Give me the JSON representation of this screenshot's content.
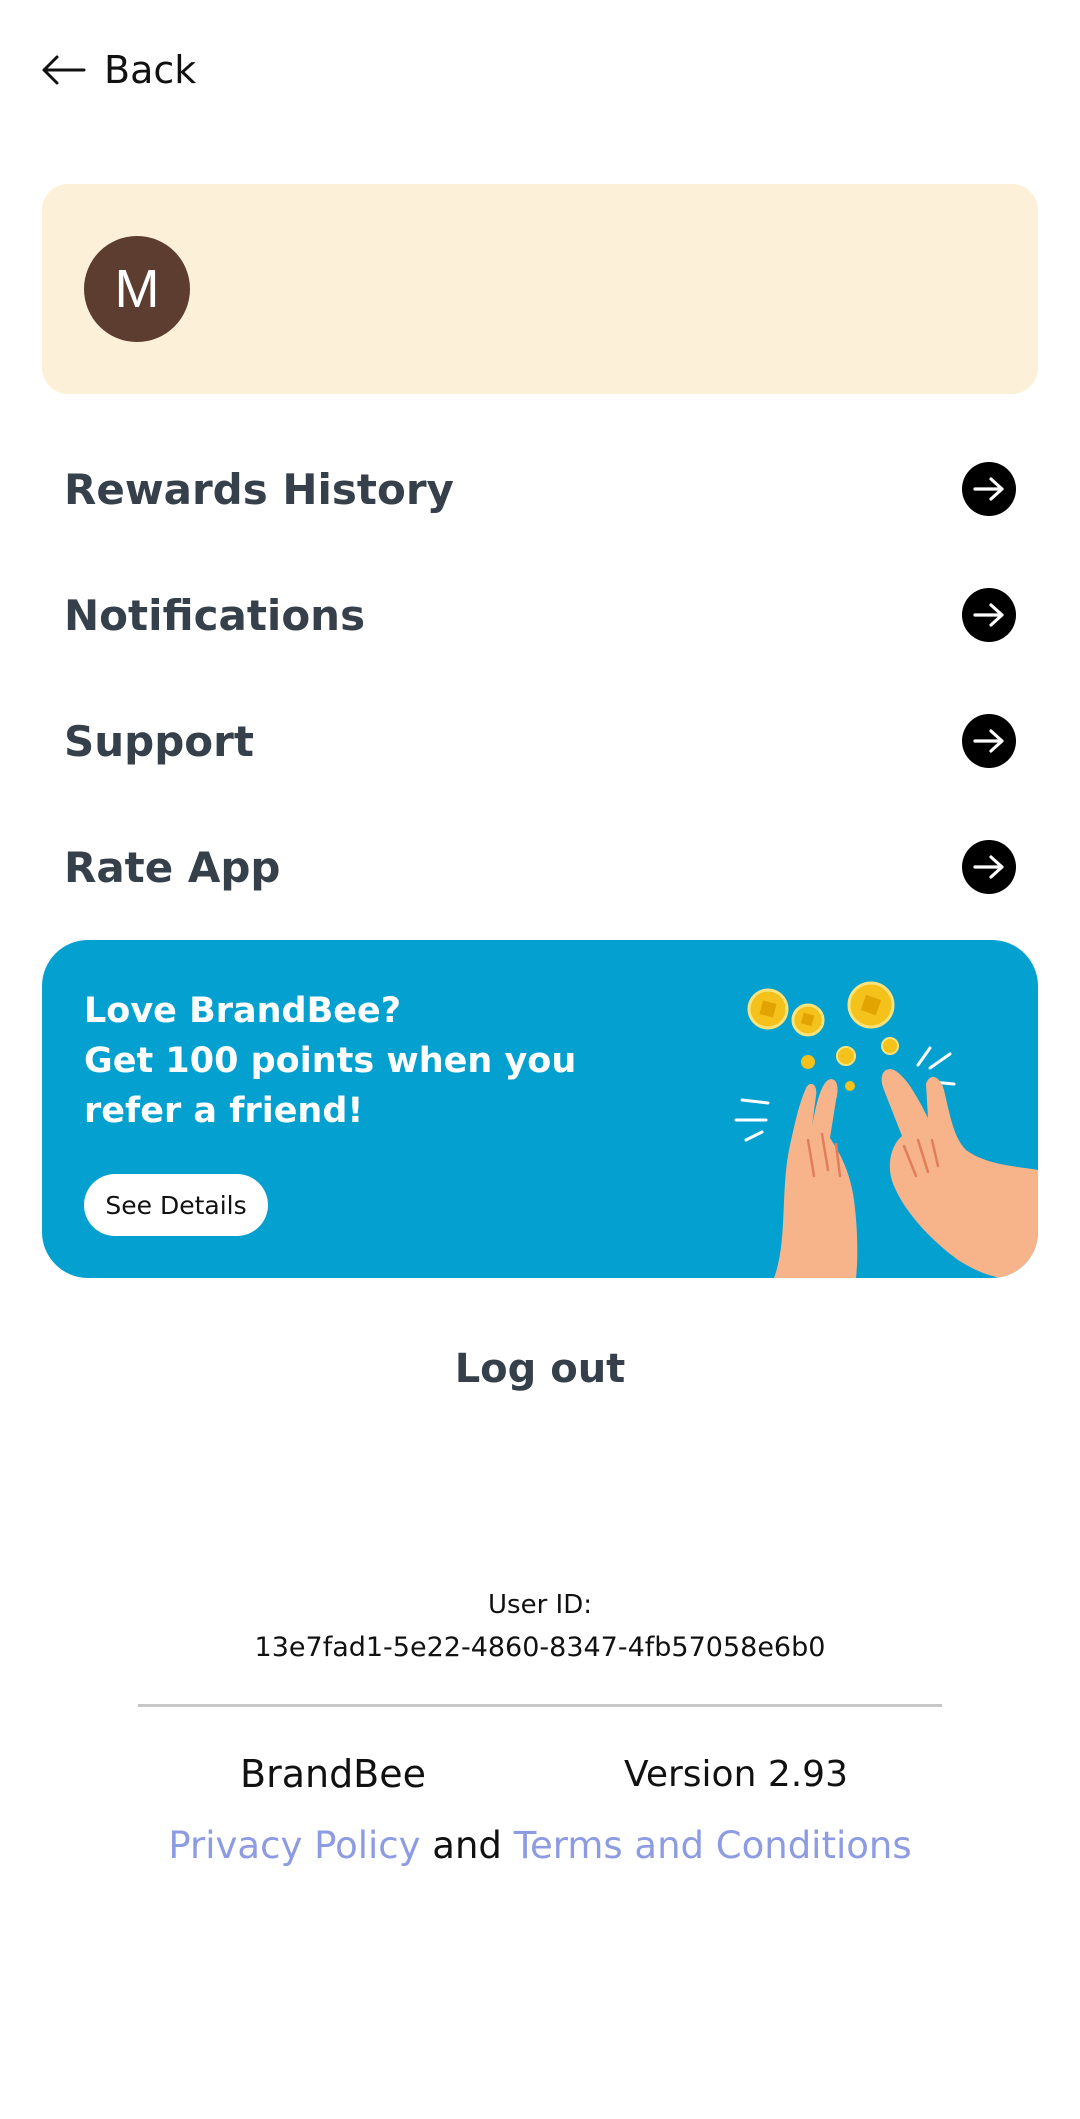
{
  "header": {
    "back_label": "Back",
    "back_icon": "arrow-left-icon"
  },
  "profile": {
    "avatar_initial": "M",
    "name": "",
    "subtitle": "",
    "card_color": "#fcf1d8",
    "avatar_color": "#5c3d30"
  },
  "menu": {
    "items": [
      {
        "label": "Rewards History",
        "icon": "arrow-right-circle-icon"
      },
      {
        "label": "Notifications",
        "icon": "arrow-right-circle-icon"
      },
      {
        "label": "Support",
        "icon": "arrow-right-circle-icon"
      },
      {
        "label": "Rate App",
        "icon": "arrow-right-circle-icon"
      }
    ]
  },
  "referral": {
    "line1": "Love BrandBee?",
    "line2": "Get 100 points when you",
    "line3": "refer a friend!",
    "button_label": "See Details",
    "background_color": "#03a0d0",
    "illustration": "high-five-coins-illustration"
  },
  "logout_label": "Log out",
  "user": {
    "id_label": "User ID:",
    "id_value": "13e7fad1-5e22-4860-8347-4fb57058e6b0"
  },
  "footer": {
    "brand": "BrandBee",
    "version": "Version 2.93",
    "privacy_label": "Privacy Policy",
    "and_label": "and",
    "terms_label": "Terms and Conditions",
    "link_color": "#8d9be3"
  }
}
